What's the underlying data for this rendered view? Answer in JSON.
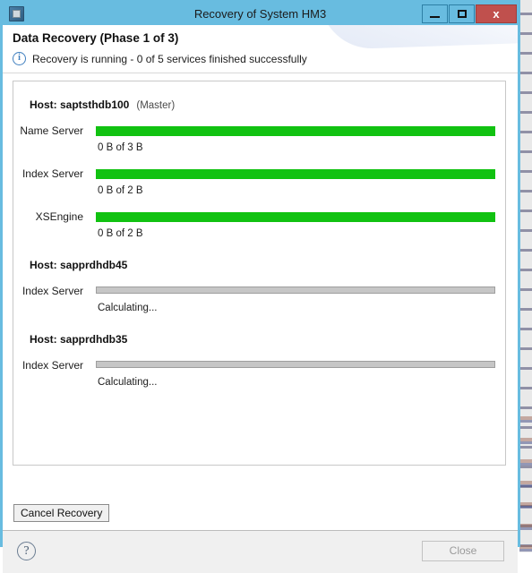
{
  "window": {
    "title": "Recovery of System HM3",
    "icon": "application-icon",
    "controls": {
      "minimize": "minimize-icon",
      "maximize": "maximize-icon",
      "close": "x"
    }
  },
  "header": {
    "title": "Data Recovery (Phase 1 of 3)",
    "status_icon": "i",
    "status_text": "Recovery is running - 0 of 5 services finished successfully"
  },
  "hosts": [
    {
      "label": "Host: saptsthdb100",
      "role": "(Master)",
      "services": [
        {
          "name": "Name Server",
          "detail": "0 B of 3 B",
          "state": "running",
          "percent": 100
        },
        {
          "name": "Index Server",
          "detail": "0 B of 2 B",
          "state": "running",
          "percent": 100
        },
        {
          "name": "XSEngine",
          "detail": "0 B of 2 B",
          "state": "running",
          "percent": 100
        }
      ]
    },
    {
      "label": "Host: sapprdhdb45",
      "role": "",
      "services": [
        {
          "name": "Index Server",
          "detail": "Calculating...",
          "state": "calculating",
          "percent": 0
        }
      ]
    },
    {
      "label": "Host: sapprdhdb35",
      "role": "",
      "services": [
        {
          "name": "Index Server",
          "detail": "Calculating...",
          "state": "calculating",
          "percent": 0
        }
      ]
    }
  ],
  "actions": {
    "cancel_recovery": "Cancel Recovery"
  },
  "footer": {
    "help": "?",
    "close": "Close"
  },
  "colors": {
    "titlebar": "#68bce0",
    "close_button": "#c0504d",
    "progress_running": "#11c211",
    "progress_idle": "#c6c6c6",
    "info_icon": "#3f7fbf"
  }
}
